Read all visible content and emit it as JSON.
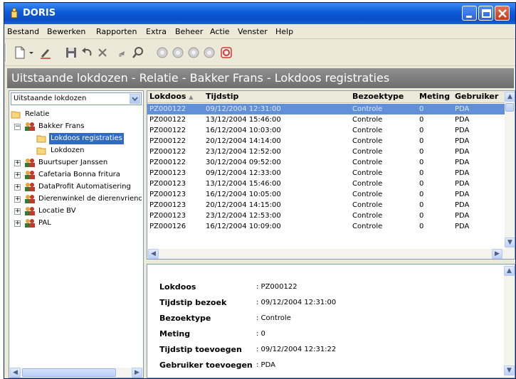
{
  "window": {
    "title": "DORIS"
  },
  "menu": [
    "Bestand",
    "Bewerken",
    "Rapporten",
    "Extra",
    "Beheer",
    "Actie",
    "Venster",
    "Help"
  ],
  "heading": "Uitstaande lokdozen - Relatie - Bakker Frans - Lokdoos registraties",
  "view_selector": {
    "value": "Uitstaande lokdozen"
  },
  "tree": [
    {
      "label": "Relatie"
    },
    {
      "label": "Bakker Frans"
    },
    {
      "label": "Lokdoos registraties"
    },
    {
      "label": "Lokdozen"
    },
    {
      "label": "Buurtsuper Janssen"
    },
    {
      "label": "Cafetaria Bonna fritura"
    },
    {
      "label": "DataProfit Automatisering"
    },
    {
      "label": "Dierenwinkel de dierenvriend"
    },
    {
      "label": "Locatie BV"
    },
    {
      "label": "PAL"
    }
  ],
  "grid": {
    "columns": [
      "Lokdoos",
      "Tijdstip",
      "Bezoektype",
      "Meting",
      "Gebruiker"
    ],
    "sort_indicator": "▲",
    "rows": [
      [
        "PZ000122",
        "09/12/2004 12:31:00",
        "Controle",
        "0",
        "PDA"
      ],
      [
        "PZ000122",
        "13/12/2004 15:46:00",
        "Controle",
        "0",
        "PDA"
      ],
      [
        "PZ000122",
        "16/12/2004 10:03:00",
        "Controle",
        "0",
        "PDA"
      ],
      [
        "PZ000122",
        "20/12/2004 14:14:00",
        "Controle",
        "0",
        "PDA"
      ],
      [
        "PZ000122",
        "23/12/2004 12:52:00",
        "Controle",
        "0",
        "PDA"
      ],
      [
        "PZ000122",
        "30/12/2004 09:52:00",
        "Controle",
        "0",
        "PDA"
      ],
      [
        "PZ000123",
        "09/12/2004 12:33:00",
        "Controle",
        "0",
        "PDA"
      ],
      [
        "PZ000123",
        "13/12/2004 15:46:00",
        "Controle",
        "0",
        "PDA"
      ],
      [
        "PZ000123",
        "16/12/2004 10:05:00",
        "Controle",
        "0",
        "PDA"
      ],
      [
        "PZ000123",
        "20/12/2004 14:15:00",
        "Controle",
        "0",
        "PDA"
      ],
      [
        "PZ000123",
        "23/12/2004 12:53:00",
        "Controle",
        "0",
        "PDA"
      ],
      [
        "PZ000126",
        "16/12/2004 10:09:00",
        "Controle",
        "0",
        "PDA"
      ]
    ]
  },
  "details": [
    {
      "label": "Lokdoos",
      "value": ": PZ000122"
    },
    {
      "label": "Tijdstip bezoek",
      "value": ": 09/12/2004 12:31:00"
    },
    {
      "label": "Bezoektype",
      "value": ": Controle"
    },
    {
      "label": "Meting",
      "value": ": 0"
    },
    {
      "label": "Tijdstip toevoegen",
      "value": ": 09/12/2004 12:31:22"
    },
    {
      "label": "Gebruiker toevoegen",
      "value": ": PDA"
    }
  ],
  "toolbar_icons": [
    "new-document-icon",
    "dropdown-arrow-icon",
    "edit-pen-icon",
    "save-icon",
    "undo-icon",
    "delete-icon",
    "pointer-icon",
    "search-icon",
    "nav-first-icon",
    "nav-prev-icon",
    "nav-next-icon",
    "nav-last-icon",
    "stop-icon"
  ],
  "colors": {
    "title_bar": "#0a4ec6",
    "selection": "#316ac5",
    "heading_bar": "#7a7a7a",
    "window_bg": "#ece9d8"
  }
}
